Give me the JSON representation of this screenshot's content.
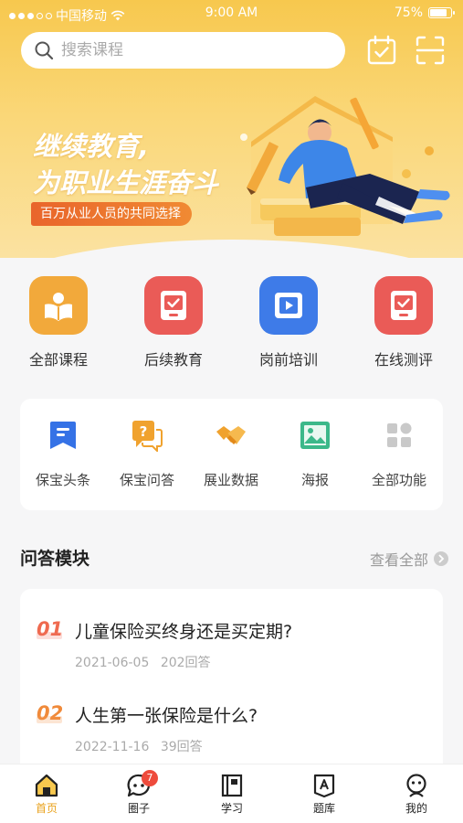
{
  "status_bar": {
    "carrier": "中国移动",
    "time": "9:00 AM",
    "battery": "75%"
  },
  "search": {
    "placeholder": "搜索课程"
  },
  "header_icons": [
    "calendar-check-icon",
    "scan-icon"
  ],
  "banner": {
    "title_line1": "继续教育,",
    "title_line2": "为职业生涯奋斗",
    "subtitle": "百万从业人员的共同选择"
  },
  "main_entries": [
    {
      "label": "全部课程",
      "icon": "open-book-icon",
      "color": "#f2a93b"
    },
    {
      "label": "后续教育",
      "icon": "tablet-check-icon",
      "color": "#ea5b57"
    },
    {
      "label": "岗前培训",
      "icon": "video-play-icon",
      "color": "#3e7be8"
    },
    {
      "label": "在线测评",
      "icon": "tablet-check-icon",
      "color": "#ea5b57"
    }
  ],
  "tools": [
    {
      "label": "保宝头条",
      "icon": "news-bookmark-icon",
      "color": "#3572e6"
    },
    {
      "label": "保宝问答",
      "icon": "question-chat-icon",
      "color": "#f0a22e"
    },
    {
      "label": "展业数据",
      "icon": "handshake-icon",
      "color": "#f0a22e"
    },
    {
      "label": "海报",
      "icon": "image-icon",
      "color": "#3cb88a"
    },
    {
      "label": "全部功能",
      "icon": "grid-icon",
      "color": "#c9c9c9"
    }
  ],
  "qa_section": {
    "title": "问答模块",
    "see_all": "查看全部",
    "items": [
      {
        "num": "01",
        "question": "儿童保险买终身还是买定期?",
        "date": "2021-06-05",
        "answers": "202回答"
      },
      {
        "num": "02",
        "question": "人生第一张保险是什么?",
        "date": "2022-11-16",
        "answers": "39回答"
      }
    ]
  },
  "tabbar": {
    "items": [
      {
        "label": "首页",
        "icon": "home-icon",
        "active": true
      },
      {
        "label": "圈子",
        "icon": "chat-bubble-icon",
        "badge": "7"
      },
      {
        "label": "学习",
        "icon": "notebook-icon"
      },
      {
        "label": "题库",
        "icon": "question-bank-icon"
      },
      {
        "label": "我的",
        "icon": "profile-icon"
      }
    ]
  },
  "colors": {
    "accent": "#f7c84e",
    "active_tab": "#e9a21c",
    "badge": "#ee4b3c"
  }
}
